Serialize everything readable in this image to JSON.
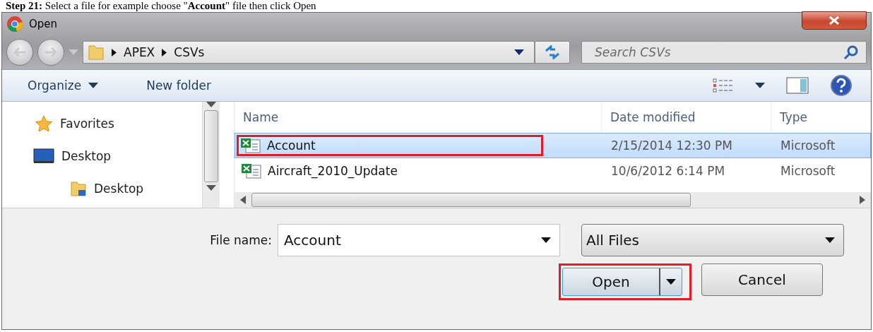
{
  "caption": "**Step 21:** Select a file for example choose \"**Account**\" file then click Open",
  "window": {
    "title": "Open"
  },
  "address": {
    "path": [
      "APEX",
      "CSVs"
    ]
  },
  "search": {
    "placeholder": "Search CSVs"
  },
  "toolbar": {
    "organize": "Organize",
    "new_folder": "New folder"
  },
  "nav_pane": [
    {
      "label": "Favorites",
      "kind": "favorites"
    },
    {
      "label": "Desktop",
      "kind": "desktop"
    },
    {
      "label": "Desktop",
      "kind": "folder"
    }
  ],
  "file_list": {
    "columns": [
      "Name",
      "Date modified",
      "Type"
    ],
    "rows": [
      {
        "name": "Account",
        "date": "2/15/2014 12:30 PM",
        "type": "Microsoft",
        "selected": true
      },
      {
        "name": "Aircraft_2010_Update",
        "date": "10/6/2012 6:14 PM",
        "type": "Microsoft",
        "selected": false
      }
    ]
  },
  "file_name": {
    "label": "File name:",
    "value": "Account"
  },
  "file_type": {
    "value": "All Files"
  },
  "buttons": {
    "open": "Open",
    "cancel": "Cancel"
  }
}
